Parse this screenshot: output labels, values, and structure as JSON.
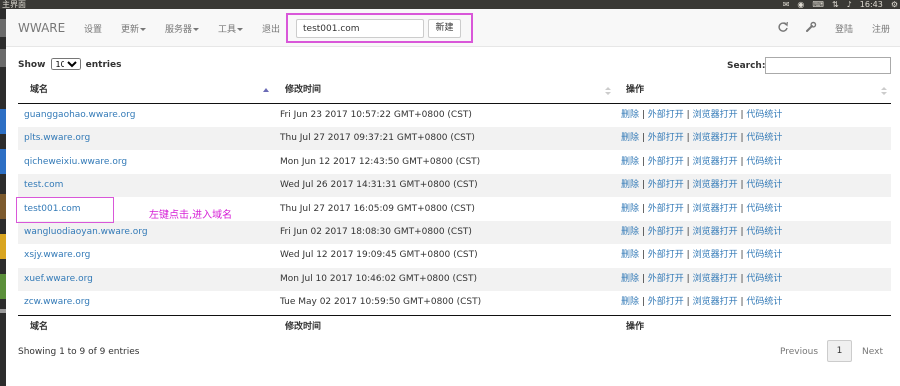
{
  "os_bar": {
    "title": "主界面",
    "time": "16:43"
  },
  "navbar": {
    "brand": "WWARE",
    "items": [
      {
        "label": "设置",
        "dropdown": false
      },
      {
        "label": "更新",
        "dropdown": true
      },
      {
        "label": "服务器",
        "dropdown": true
      },
      {
        "label": "工具",
        "dropdown": true
      },
      {
        "label": "退出",
        "dropdown": false
      }
    ],
    "domain_input_value": "test001.com",
    "new_button": "新建",
    "login": "登陆",
    "register": "注册"
  },
  "table_controls": {
    "show_label": "Show",
    "entries_value": "10",
    "entries_label": "entries",
    "search_label": "Search:"
  },
  "table": {
    "columns": [
      "域名",
      "修改时间",
      "操作"
    ],
    "rows": [
      {
        "domain": "guanggaohao.wware.org",
        "modified": "Fri Jun 23 2017 10:57:22 GMT+0800 (CST)"
      },
      {
        "domain": "plts.wware.org",
        "modified": "Thu Jul 27 2017 09:37:21 GMT+0800 (CST)"
      },
      {
        "domain": "qicheweixiu.wware.org",
        "modified": "Mon Jun 12 2017 12:43:50 GMT+0800 (CST)"
      },
      {
        "domain": "test.com",
        "modified": "Wed Jul 26 2017 14:31:31 GMT+0800 (CST)"
      },
      {
        "domain": "test001.com",
        "modified": "Thu Jul 27 2017 16:05:09 GMT+0800 (CST)"
      },
      {
        "domain": "wangluodiaoyan.wware.org",
        "modified": "Fri Jun 02 2017 18:08:30 GMT+0800 (CST)"
      },
      {
        "domain": "xsjy.wware.org",
        "modified": "Wed Jul 12 2017 19:09:45 GMT+0800 (CST)"
      },
      {
        "domain": "xuef.wware.org",
        "modified": "Mon Jul 10 2017 10:46:02 GMT+0800 (CST)"
      },
      {
        "domain": "zcw.wware.org",
        "modified": "Tue May 02 2017 10:59:50 GMT+0800 (CST)"
      }
    ],
    "actions": [
      "删除",
      "外部打开",
      "浏览器打开",
      "代码统计"
    ],
    "action_separator": " | "
  },
  "annotation": "左键点击,进入域名",
  "footer": {
    "info": "Showing 1 to 9 of 9 entries",
    "previous": "Previous",
    "page": "1",
    "next": "Next"
  },
  "colors": {
    "link": "#337ab7",
    "highlight": "#d957d9",
    "annotation": "#d61fd6"
  }
}
